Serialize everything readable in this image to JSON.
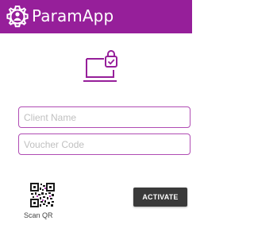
{
  "app": {
    "title": "ParamApp",
    "brand_color": "#961f9a"
  },
  "icons": {
    "logo": "gear-person-icon",
    "device": "laptop-lock-icon",
    "qr": "qr-code-icon"
  },
  "form": {
    "client_name": {
      "value": "",
      "placeholder": "Client Name"
    },
    "voucher_code": {
      "value": "",
      "placeholder": "Voucher Code"
    }
  },
  "actions": {
    "scan_label": "Scan QR",
    "activate_label": "ACTIVATE"
  }
}
